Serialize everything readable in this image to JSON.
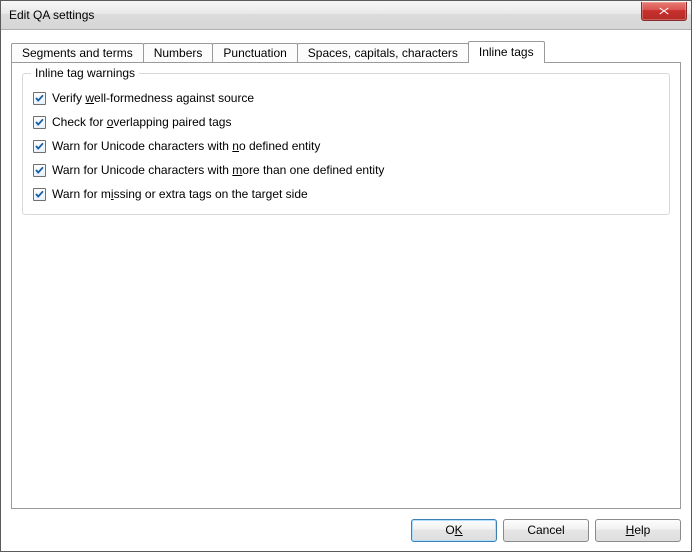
{
  "window": {
    "title": "Edit QA settings"
  },
  "tabs": {
    "segments": "Segments and terms",
    "numbers": "Numbers",
    "punctuation": "Punctuation",
    "spaces": "Spaces, capitals, characters",
    "inline": "Inline tags"
  },
  "group": {
    "legend": "Inline tag warnings",
    "opts": {
      "wellformed": {
        "checked": true,
        "pre": "Verify ",
        "u": "w",
        "post": "ell-formedness against source"
      },
      "overlap": {
        "checked": true,
        "pre": "Check for ",
        "u": "o",
        "post": "verlapping paired tags"
      },
      "nodef": {
        "checked": true,
        "pre": "Warn for Unicode characters with ",
        "u": "n",
        "post": "o defined entity"
      },
      "moreone": {
        "checked": true,
        "pre": "Warn for Unicode characters with ",
        "u": "m",
        "post": "ore than one defined entity"
      },
      "missingextra": {
        "checked": true,
        "pre": "Warn for m",
        "u": "i",
        "post": "ssing or extra tags on the target side"
      }
    }
  },
  "buttons": {
    "ok_pre": "O",
    "ok_u": "K",
    "ok_post": "",
    "cancel": "Cancel",
    "help_pre": "",
    "help_u": "H",
    "help_post": "elp"
  }
}
